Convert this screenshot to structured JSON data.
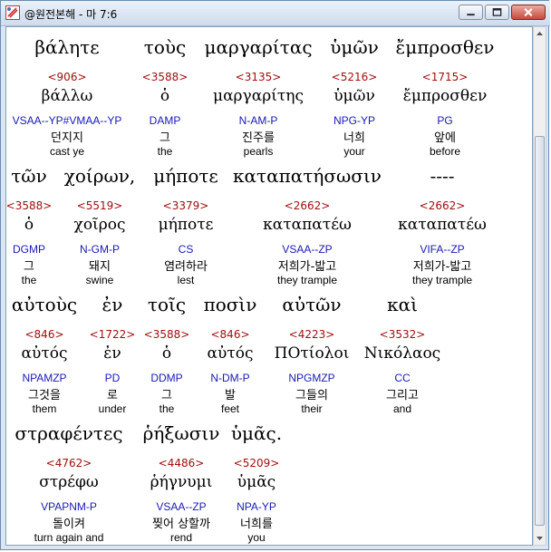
{
  "window": {
    "title": "@원전본해 - 마 7:6"
  },
  "rows": [
    {
      "words": [
        {
          "greek": "βάλητε",
          "strong": "<906>",
          "lemma": "βάλλω",
          "morph": "VSAA--YP#VMAA--YP",
          "korean": "던지지",
          "english": "cast ye"
        },
        {
          "greek": "τοὺς",
          "strong": "<3588>",
          "lemma": "ὁ",
          "morph": "DAMP",
          "korean": "그",
          "english": "the"
        },
        {
          "greek": "μαργαρίτας",
          "strong": "<3135>",
          "lemma": "μαργαρίτης",
          "morph": "N-AM-P",
          "korean": "진주를",
          "english": "pearls"
        },
        {
          "greek": "ὑμῶν",
          "strong": "<5216>",
          "lemma": "ὑμῶν",
          "morph": "NPG-YP",
          "korean": "너희",
          "english": "your"
        },
        {
          "greek": "ἔμπροσθεν",
          "strong": "<1715>",
          "lemma": "ἔμπροσθεν",
          "morph": "PG",
          "korean": "앞에",
          "english": "before"
        }
      ]
    },
    {
      "words": [
        {
          "greek": "τῶν",
          "strong": "<3588>",
          "lemma": "ὁ",
          "morph": "DGMP",
          "korean": "그",
          "english": "the"
        },
        {
          "greek": "χοίρων,",
          "strong": "<5519>",
          "lemma": "χοῖρος",
          "morph": "N-GM-P",
          "korean": "돼지",
          "english": "swine"
        },
        {
          "greek": "μήποτε",
          "strong": "<3379>",
          "lemma": "μήποτε",
          "morph": "CS",
          "korean": "염려하라",
          "english": "lest"
        },
        {
          "greek": "καταπατήσωσιν",
          "strong": "<2662>",
          "lemma": "καταπατέω",
          "morph": "VSAA--ZP",
          "korean": "저희가-밟고",
          "english": "they trample"
        },
        {
          "greek": "----",
          "strong": "<2662>",
          "lemma": "καταπατέω",
          "morph": "VIFA--ZP",
          "korean": "저희가-밟고",
          "english": "they trample"
        }
      ]
    },
    {
      "words": [
        {
          "greek": "αὐτοὺς",
          "strong": "<846>",
          "lemma": "αὐτός",
          "morph": "NPAMZP",
          "korean": "그것을",
          "english": "them"
        },
        {
          "greek": "ἐν",
          "strong": "<1722>",
          "lemma": "ἐν",
          "morph": "PD",
          "korean": "로",
          "english": "under"
        },
        {
          "greek": "τοῖς",
          "strong": "<3588>",
          "lemma": "ὁ",
          "morph": "DDMP",
          "korean": "그",
          "english": "the"
        },
        {
          "greek": "ποσὶν",
          "strong": "<846>",
          "lemma": "αὐτός",
          "morph": "N-DM-P",
          "korean": "발",
          "english": "feet"
        },
        {
          "greek": "αὐτῶν",
          "strong": "<4223>",
          "lemma": "ΠΟτίολοι",
          "morph": "NPGMZP",
          "korean": "그들의",
          "english": "their"
        },
        {
          "greek": "καὶ",
          "strong": "<3532>",
          "lemma": "Νικόλαος",
          "morph": "CC",
          "korean": "그리고",
          "english": "and"
        }
      ]
    },
    {
      "words": [
        {
          "greek": "στραφέντες",
          "strong": "<4762>",
          "lemma": "στρέφω",
          "morph": "VPAPNM-P",
          "korean": "돌이켜",
          "english": "turn again and"
        },
        {
          "greek": "ῥήξωσιν",
          "strong": "<4486>",
          "lemma": "ῥήγνυμι",
          "morph": "VSAA--ZP",
          "korean": "찢어 상할까",
          "english": "rend"
        },
        {
          "greek": "ὑμᾶς.",
          "strong": "<5209>",
          "lemma": "ὑμᾶς",
          "morph": "NPA-YP",
          "korean": "너희를",
          "english": "you"
        }
      ]
    }
  ]
}
